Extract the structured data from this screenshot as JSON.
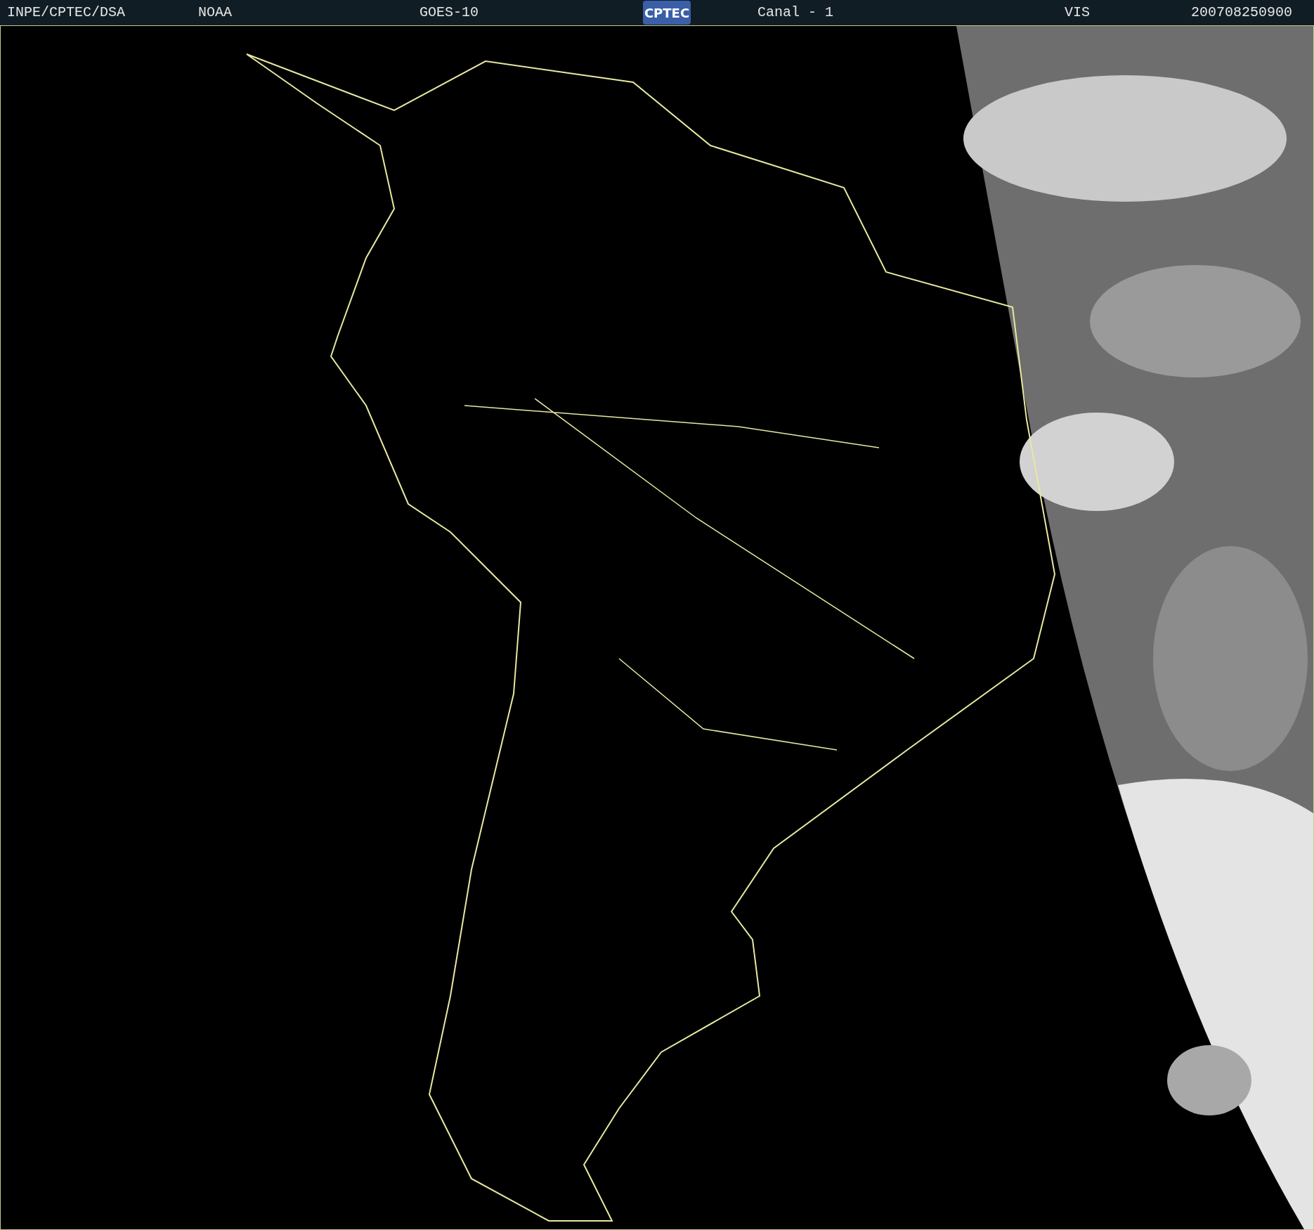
{
  "header": {
    "agency": "INPE/CPTEC/DSA",
    "source": "NOAA",
    "satellite": "GOES-10",
    "logo": "CPTEC",
    "channel": "Canal - 1",
    "band": "VIS",
    "timestamp": "200708250900"
  }
}
